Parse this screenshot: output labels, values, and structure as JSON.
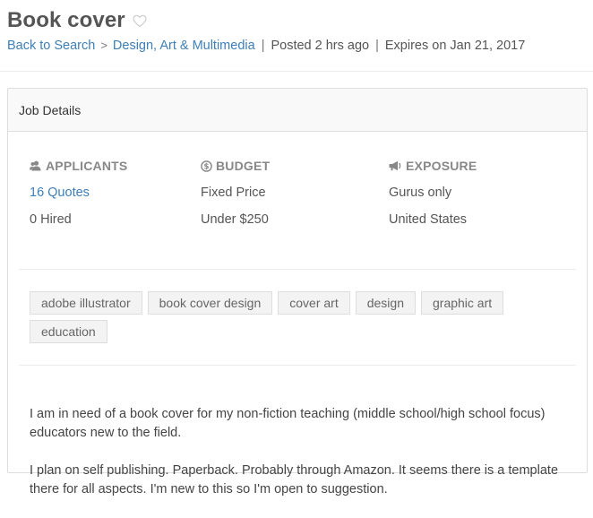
{
  "header": {
    "title": "Book cover",
    "favorite_icon": "heart-outline-icon",
    "breadcrumb": {
      "back_label": "Back to Search",
      "separator": ">",
      "category_label": "Design, Art & Multimedia"
    },
    "posted": "Posted 2 hrs ago",
    "expires": "Expires on Jan 21, 2017",
    "pipe": "|"
  },
  "panel": {
    "heading": "Job Details",
    "stats": [
      {
        "icon": "applicants-icon",
        "label": "APPLICANTS",
        "values": [
          "16 Quotes",
          "0 Hired"
        ]
      },
      {
        "icon": "dollar-circle-icon",
        "label": "BUDGET",
        "values": [
          "Fixed Price",
          "Under $250"
        ]
      },
      {
        "icon": "megaphone-icon",
        "label": "EXPOSURE",
        "values": [
          "Gurus only",
          "United States"
        ]
      }
    ],
    "tags": [
      "adobe illustrator",
      "book cover design",
      "cover art",
      "design",
      "graphic art",
      "education"
    ],
    "description": [
      "I am in need of a book cover for my non-fiction teaching (middle school/high school focus) educators new to the field.",
      "I plan on self publishing.  Paperback.  Probably through Amazon.  It seems there is a template there for all aspects.  I'm new to this so I'm open to suggestion."
    ]
  },
  "colors": {
    "link": "#3e7fb8",
    "text": "#555555",
    "heading_gray": "#888888",
    "tag_bg": "#f3f3f3",
    "panel_heading_bg": "#f9f9f9",
    "border": "#dddddd"
  }
}
